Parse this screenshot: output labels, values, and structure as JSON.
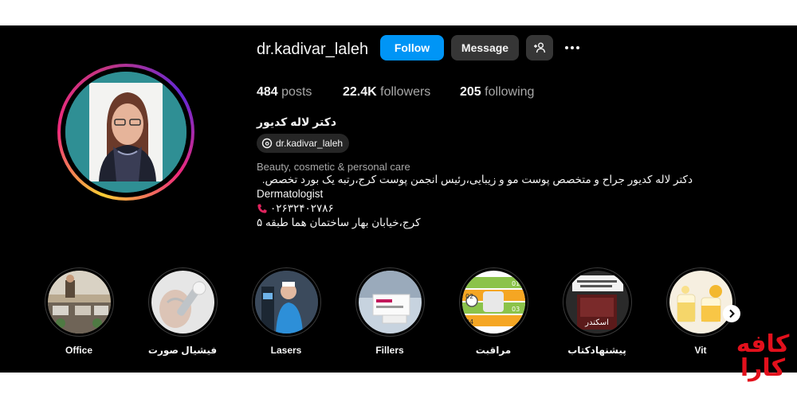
{
  "profile": {
    "username": "dr.kadivar_laleh",
    "follow_label": "Follow",
    "message_label": "Message",
    "stats": {
      "posts_count": "484",
      "posts_label": "posts",
      "followers_count": "22.4K",
      "followers_label": "followers",
      "following_count": "205",
      "following_label": "following"
    },
    "full_name": "دکتر لاله کدیور",
    "threads_handle": "dr.kadivar_laleh",
    "category": "Beauty, cosmetic & personal care",
    "bio_lines": [
      "دکتر لاله کدیور جراح و متخصص پوست مو و زیبایی،رئیس انجمن پوست کرج،رتبه یک بورد تخصص.",
      "Dermatologist",
      "۰۲۶۳۲۴۰۲۷۸۶",
      "کرج،خیابان بهار ساختمان هما طبقه ۵"
    ]
  },
  "highlights": [
    {
      "label": "Office"
    },
    {
      "label": "فیشیال صورت"
    },
    {
      "label": "Lasers"
    },
    {
      "label": "Fillers"
    },
    {
      "label": "مراقبت"
    },
    {
      "label": "پیشنهادکتاب"
    },
    {
      "label": "Vit"
    }
  ],
  "highlight_thumb_text": {
    "care_numbers": [
      "01",
      "02",
      "03",
      "04"
    ],
    "book_title": "اسکندر"
  },
  "watermark": {
    "line1": "کافه",
    "line2": "کارا"
  },
  "colors": {
    "follow": "#0095f6",
    "button": "#363636",
    "background": "#000000",
    "watermark": "#e3101c"
  },
  "icons": [
    "add-person-icon",
    "more-icon",
    "threads-icon",
    "phone-icon",
    "chevron-right-icon"
  ]
}
